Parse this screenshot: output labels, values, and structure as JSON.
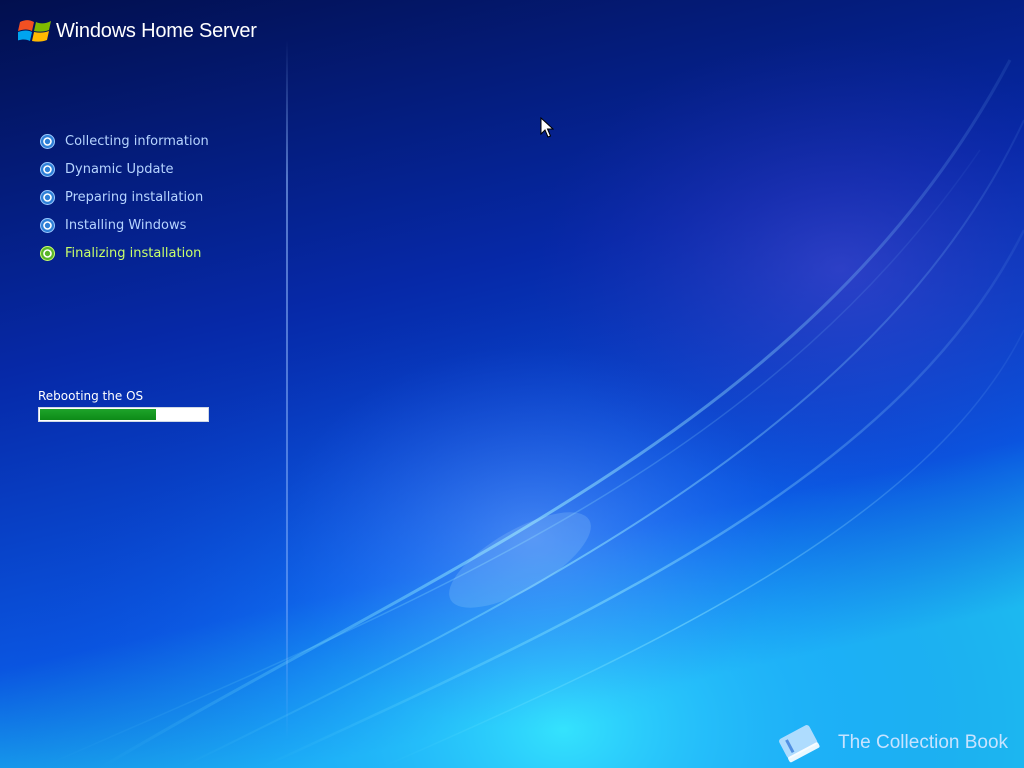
{
  "header": {
    "product_name": "Windows Home Server"
  },
  "steps": [
    {
      "label": "Collecting information",
      "state": "done"
    },
    {
      "label": "Dynamic Update",
      "state": "done"
    },
    {
      "label": "Preparing installation",
      "state": "done"
    },
    {
      "label": "Installing Windows",
      "state": "done"
    },
    {
      "label": "Finalizing installation",
      "state": "active"
    }
  ],
  "status": {
    "label": "Rebooting the OS",
    "progress_fraction": 0.7
  },
  "watermark": {
    "text": "The Collection Book"
  },
  "colors": {
    "background": "#041a7a",
    "step_text": "#b6d4ff",
    "active_step_text": "#c9ff6a",
    "progress_fill": "#1ea42a"
  }
}
